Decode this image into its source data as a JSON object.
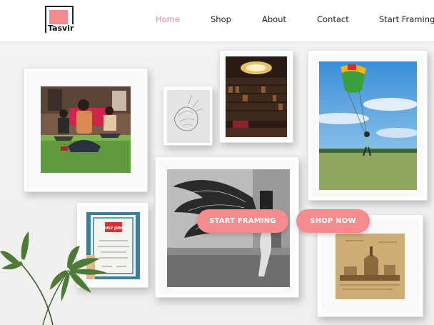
{
  "brand": {
    "name": "Tasvir",
    "accent": "#f58a8f"
  },
  "nav": {
    "items": [
      {
        "label": "Home",
        "active": true
      },
      {
        "label": "Shop",
        "active": false
      },
      {
        "label": "About",
        "active": false
      },
      {
        "label": "Contact",
        "active": false
      },
      {
        "label": "Start Framing",
        "active": false
      }
    ]
  },
  "hero": {
    "start_framing_label": "START FRAMING",
    "shop_now_label": "SHOP NOW",
    "certificate_text": "BUSY JUMP"
  },
  "colors": {
    "accent": "#f58a8f",
    "wall": "#f1f1f0",
    "frame": "#fafafa"
  }
}
